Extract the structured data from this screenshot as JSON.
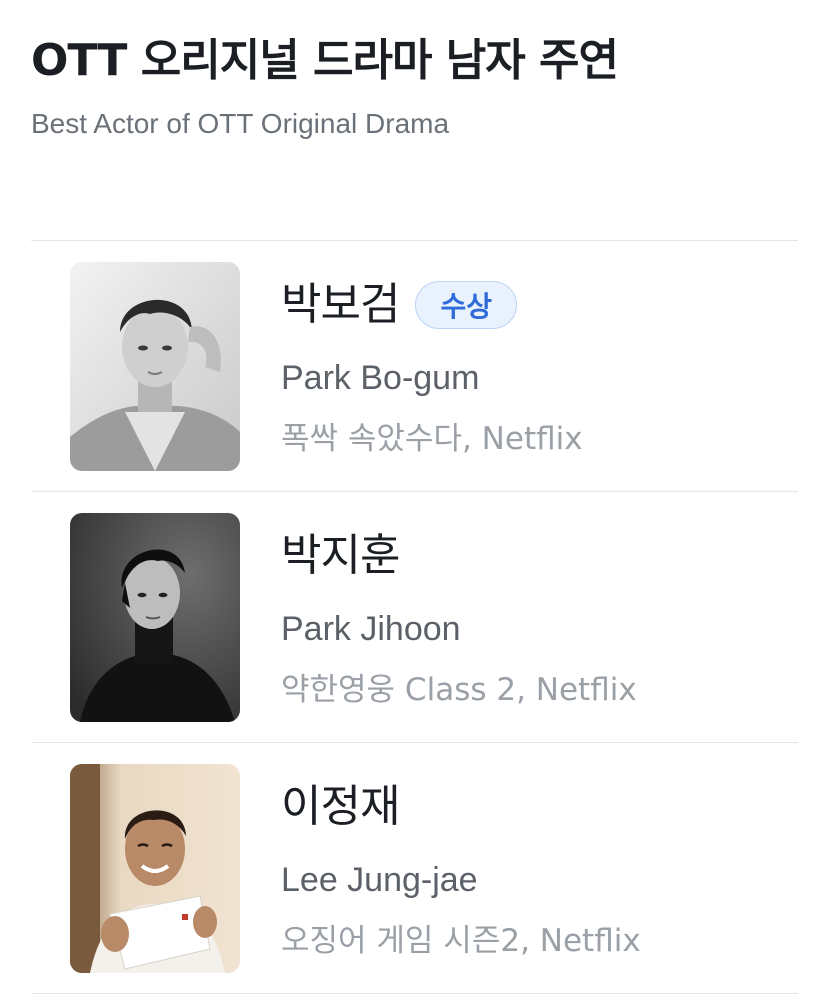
{
  "header": {
    "title": "OTT 오리지널 드라마 남자 주연",
    "subtitle": "Best Actor of OTT Original Drama"
  },
  "nominees": [
    {
      "name_ko": "박보검",
      "badge": "수상",
      "name_en": "Park Bo-gum",
      "work": "폭싹 속았수다, Netflix"
    },
    {
      "name_ko": "박지훈",
      "name_en": "Park Jihoon",
      "work": "약한영웅 Class 2, Netflix"
    },
    {
      "name_ko": "이정재",
      "name_en": "Lee Jung-jae",
      "work": "오징어 게임 시즌2, Netflix"
    }
  ],
  "colors": {
    "badge_text": "#2f6bd8",
    "badge_bg": "#e9f1fd",
    "divider": "#e4e6e9"
  }
}
